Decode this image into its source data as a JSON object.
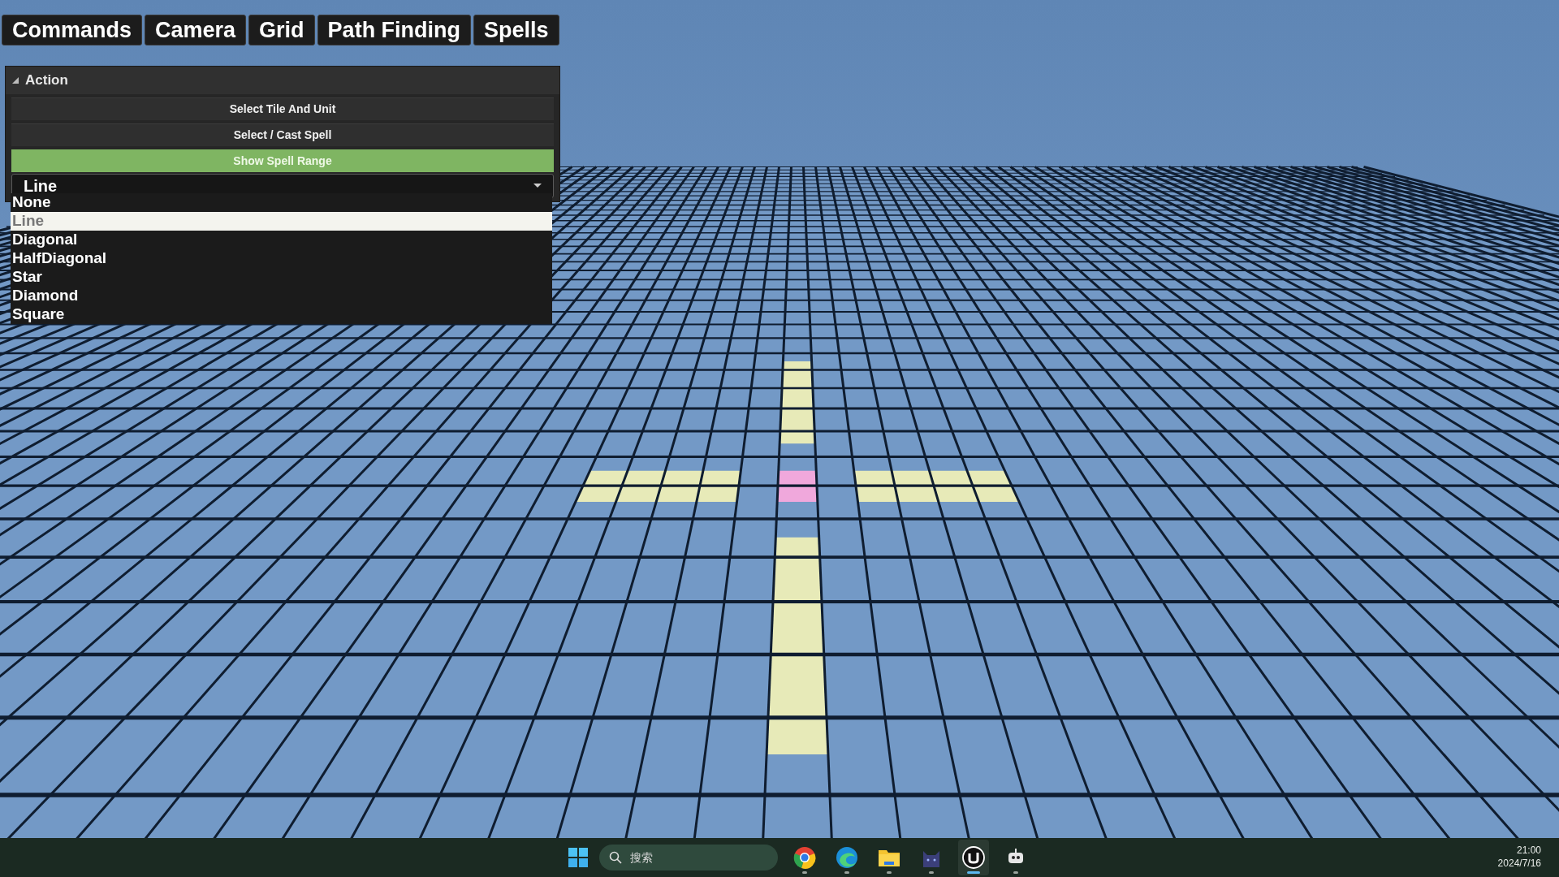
{
  "tabs": [
    {
      "label": "Commands"
    },
    {
      "label": "Camera"
    },
    {
      "label": "Grid"
    },
    {
      "label": "Path Finding"
    },
    {
      "label": "Spells"
    }
  ],
  "panel": {
    "title": "Action",
    "expanded": true,
    "buttons": [
      {
        "label": "Select Tile And Unit",
        "active": false
      },
      {
        "label": "Select / Cast Spell",
        "active": false
      },
      {
        "label": "Show Spell Range",
        "active": true
      }
    ],
    "dropdown": {
      "value": "Line",
      "open": true,
      "options": [
        {
          "label": "None",
          "selected": false
        },
        {
          "label": "Line",
          "selected": true
        },
        {
          "label": "Diagonal",
          "selected": false
        },
        {
          "label": "HalfDiagonal",
          "selected": false
        },
        {
          "label": "Star",
          "selected": false
        },
        {
          "label": "Diamond",
          "selected": false
        },
        {
          "label": "Square",
          "selected": false
        }
      ]
    }
  },
  "taskbar": {
    "search": {
      "placeholder": "搜索"
    },
    "apps": [
      {
        "kind": "ring",
        "active": false
      },
      {
        "kind": "wave",
        "active": false
      },
      {
        "kind": "folder",
        "active": false
      },
      {
        "kind": "cat",
        "active": false
      },
      {
        "kind": "engine",
        "active": true
      },
      {
        "kind": "robot",
        "active": false
      }
    ],
    "clock": {
      "time": "21:00",
      "date": "2024/7/16"
    }
  }
}
